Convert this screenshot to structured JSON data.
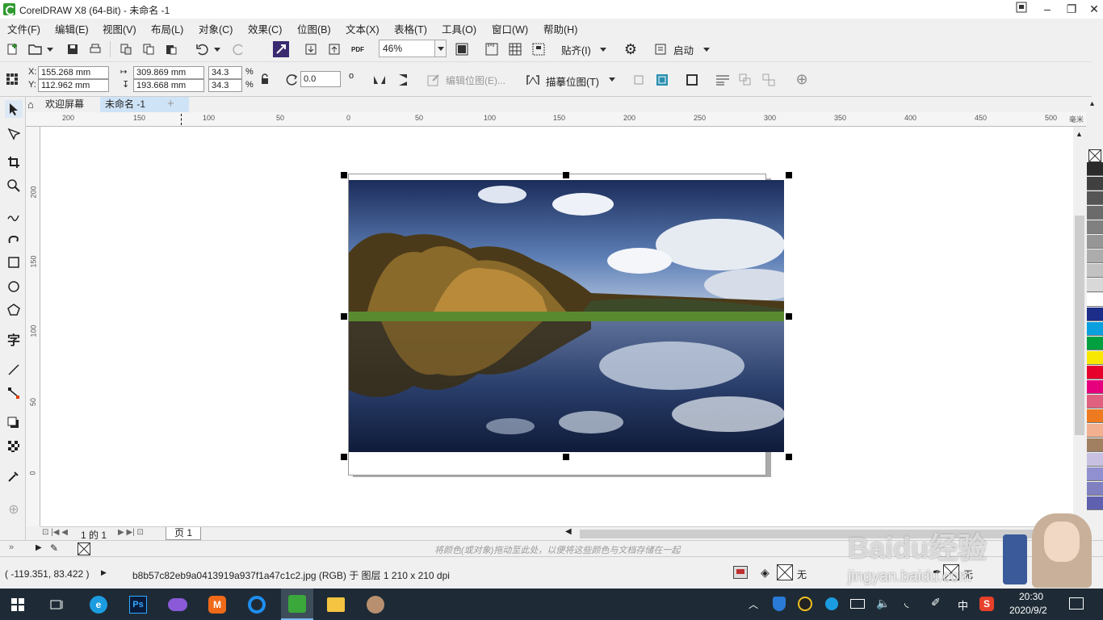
{
  "window": {
    "title": "CorelDRAW X8 (64-Bit) - 未命名 -1"
  },
  "menu": [
    "文件(F)",
    "编辑(E)",
    "视图(V)",
    "布局(L)",
    "对象(C)",
    "效果(C)",
    "位图(B)",
    "文本(X)",
    "表格(T)",
    "工具(O)",
    "窗口(W)",
    "帮助(H)"
  ],
  "toolbar": {
    "zoom": "46%",
    "snap_label": "贴齐(I)",
    "launch_label": "启动"
  },
  "property_bar": {
    "x": "155.268 mm",
    "y": "112.962 mm",
    "x_label": "X:",
    "y_label": "Y:",
    "width": "309.869 mm",
    "height": "193.668 mm",
    "scale_w": "34.3",
    "scale_h": "34.3",
    "pct": "%",
    "rotation": "0.0",
    "degree": "o",
    "edit_bitmap": "编辑位图(E)...",
    "trace_bitmap": "描摹位图(T)"
  },
  "doc_tabs": {
    "welcome": "欢迎屏幕",
    "document": "未命名 -1"
  },
  "ruler": {
    "h_ticks": [
      "200",
      "150",
      "100",
      "50",
      "0",
      "50",
      "100",
      "150",
      "200",
      "250",
      "300",
      "350",
      "400",
      "450",
      "500"
    ],
    "unit": "毫米",
    "v_ticks": [
      "200",
      "150",
      "100",
      "50",
      "0"
    ]
  },
  "page_nav": {
    "page_count": "1 的 1",
    "page_tab": "页 1"
  },
  "color_strip": {
    "hint": "将颜色(或对象)拖动至此处，以便将这些颜色与文档存储在一起"
  },
  "status": {
    "coords": "( -119.351, 83.422 )",
    "object_info": "b8b57c82eb9a0413919a937f1a47c1c2.jpg (RGB) 于 图层 1 210 x 210 dpi",
    "fill_none": "无",
    "outline_none": "无"
  },
  "watermark": {
    "text": "Baidu经验",
    "url": "jingyan.baidu.com"
  },
  "taskbar": {
    "time": "20:30",
    "date": "2020/9/2",
    "ime": "中"
  },
  "palette_colors": [
    "#2b2b2b",
    "#404040",
    "#555555",
    "#6b6b6b",
    "#808080",
    "#969696",
    "#acacac",
    "#c2c2c2",
    "#d8d8d8",
    "#ffffff",
    "#1c2e8a",
    "#0aa0e0",
    "#00a040",
    "#f8e800",
    "#e8002c",
    "#e6007e",
    "#e06080",
    "#ee7a20",
    "#f2b090",
    "#a08060",
    "#c8c0e0",
    "#9090d0",
    "#8080c0",
    "#6060b0"
  ]
}
